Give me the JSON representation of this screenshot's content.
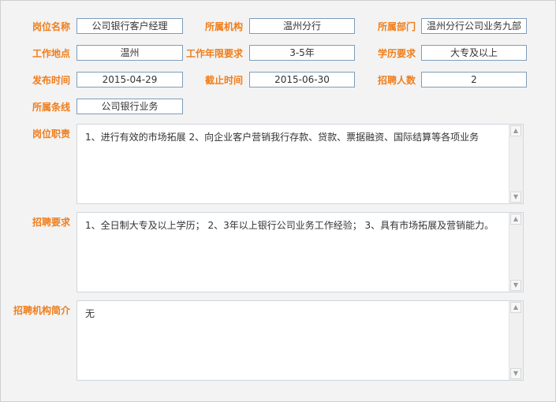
{
  "form": {
    "row1": {
      "position_label": "岗位名称",
      "position_value": "公司银行客户经理",
      "org_label": "所属机构",
      "org_value": "温州分行",
      "dept_label": "所属部门",
      "dept_value": "温州分行公司业务九部"
    },
    "row2": {
      "location_label": "工作地点",
      "location_value": "温州",
      "years_label": "工作年限要求",
      "years_value": "3-5年",
      "edu_label": "学历要求",
      "edu_value": "大专及以上"
    },
    "row3": {
      "publish_label": "发布时间",
      "publish_value": "2015-04-29",
      "deadline_label": "截止时间",
      "deadline_value": "2015-06-30",
      "headcount_label": "招聘人数",
      "headcount_value": "2"
    },
    "row4": {
      "line_label": "所属条线",
      "line_value": "公司银行业务"
    },
    "duties": {
      "label": "岗位职责",
      "text": "1、进行有效的市场拓展 2、向企业客户营销我行存款、贷款、票据融资、国际结算等各项业务"
    },
    "requirements": {
      "label": "招聘要求",
      "text": "1、全日制大专及以上学历； 2、3年以上银行公司业务工作经验； 3、具有市场拓展及营销能力。"
    },
    "intro": {
      "label": "招聘机构简介",
      "text": "无"
    }
  }
}
